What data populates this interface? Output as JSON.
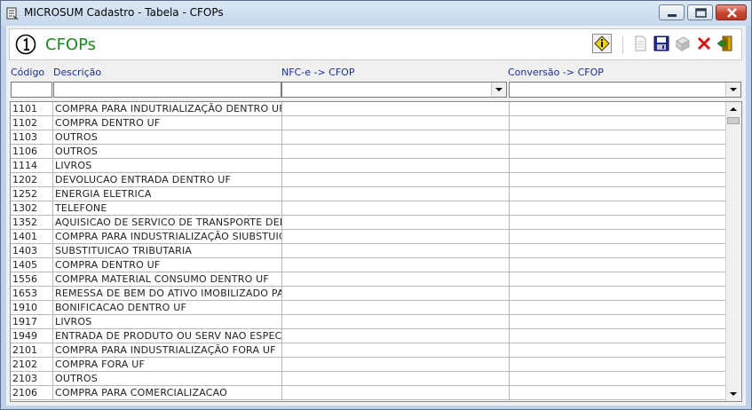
{
  "window": {
    "title": "MICROSUM Cadastro - Tabela - CFOPs"
  },
  "header": {
    "number_icon": "circled-one-icon",
    "title": "CFOPs"
  },
  "toolbar": {
    "buttons": [
      "info-icon",
      "new-document-icon",
      "save-icon",
      "edit-icon",
      "delete-icon",
      "exit-icon"
    ]
  },
  "columns": {
    "codigo": "Código",
    "descricao": "Descrição",
    "nfce_cfop": "NFC-e -> CFOP",
    "conversao_cfop": "Conversão -> CFOP"
  },
  "filters": {
    "codigo": "",
    "descricao": "",
    "nfce_cfop": "",
    "conversao_cfop": ""
  },
  "rows": [
    {
      "codigo": "1101",
      "descricao": "COMPRA PARA INDUTRIALIZAÇÃO DENTRO UF",
      "nfce": "",
      "conv": ""
    },
    {
      "codigo": "1102",
      "descricao": "COMPRA DENTRO UF",
      "nfce": "",
      "conv": ""
    },
    {
      "codigo": "1103",
      "descricao": "OUTROS",
      "nfce": "",
      "conv": ""
    },
    {
      "codigo": "1106",
      "descricao": "OUTROS",
      "nfce": "",
      "conv": ""
    },
    {
      "codigo": "1114",
      "descricao": "LIVROS",
      "nfce": "",
      "conv": ""
    },
    {
      "codigo": "1202",
      "descricao": "DEVOLUCAO ENTRADA DENTRO UF",
      "nfce": "",
      "conv": ""
    },
    {
      "codigo": "1252",
      "descricao": "ENERGIA ELETRICA",
      "nfce": "",
      "conv": ""
    },
    {
      "codigo": "1302",
      "descricao": "TELEFONE",
      "nfce": "",
      "conv": ""
    },
    {
      "codigo": "1352",
      "descricao": "AQUISICAO DE SERVICO DE TRANSPORTE DENT",
      "nfce": "",
      "conv": ""
    },
    {
      "codigo": "1401",
      "descricao": "COMPRA PARA INDUSTRIALIZAÇÃO SIUBSTUIÇÃ",
      "nfce": "",
      "conv": ""
    },
    {
      "codigo": "1403",
      "descricao": "SUBSTITUICAO TRIBUTARIA",
      "nfce": "",
      "conv": ""
    },
    {
      "codigo": "1405",
      "descricao": "COMPRA DENTRO UF",
      "nfce": "",
      "conv": ""
    },
    {
      "codigo": "1556",
      "descricao": "COMPRA MATERIAL CONSUMO DENTRO UF",
      "nfce": "",
      "conv": ""
    },
    {
      "codigo": "1653",
      "descricao": "REMESSA DE BEM DO ATIVO IMOBILIZADO PARA",
      "nfce": "",
      "conv": ""
    },
    {
      "codigo": "1910",
      "descricao": "BONIFICACAO DENTRO UF",
      "nfce": "",
      "conv": ""
    },
    {
      "codigo": "1917",
      "descricao": "LIVROS",
      "nfce": "",
      "conv": ""
    },
    {
      "codigo": "1949",
      "descricao": "ENTRADA DE PRODUTO OU SERV NAO ESPECIFI",
      "nfce": "",
      "conv": ""
    },
    {
      "codigo": "2101",
      "descricao": "COMPRA PARA INDUSTRIALIZAÇÃO FORA UF",
      "nfce": "",
      "conv": ""
    },
    {
      "codigo": "2102",
      "descricao": "COMPRA FORA UF",
      "nfce": "",
      "conv": ""
    },
    {
      "codigo": "2103",
      "descricao": "OUTROS",
      "nfce": "",
      "conv": ""
    },
    {
      "codigo": "2106",
      "descricao": "COMPRA PARA COMERCIALIZACAO",
      "nfce": "",
      "conv": ""
    }
  ]
}
